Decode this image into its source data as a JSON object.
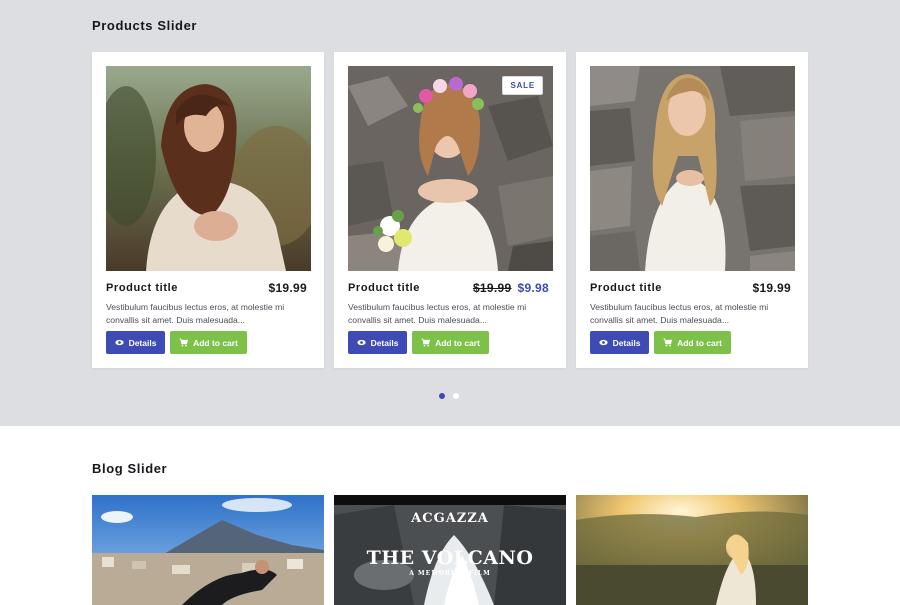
{
  "products_slider": {
    "title": "Products Slider",
    "products": [
      {
        "title": "Product title",
        "price": "$19.99",
        "description": "Vestibulum faucibus lectus eros, at molestie mi convallis sit amet. Duis malesuada...",
        "details_label": "Details",
        "cart_label": "Add to cart"
      },
      {
        "title": "Product title",
        "badge": "SALE",
        "old_price": "$19.99",
        "price": "$9.98",
        "description": "Vestibulum faucibus lectus eros, at molestie mi convallis sit amet. Duis malesuada...",
        "details_label": "Details",
        "cart_label": "Add to cart"
      },
      {
        "title": "Product title",
        "price": "$19.99",
        "description": "Vestibulum faucibus lectus eros, at molestie mi convallis sit amet. Duis malesuada...",
        "details_label": "Details",
        "cart_label": "Add to cart"
      }
    ],
    "pagination": {
      "pages": 2,
      "active_page": 1
    }
  },
  "blog_slider": {
    "title": "Blog Slider",
    "posts": [
      {
        "image": "city-mountain-photo"
      },
      {
        "image": "volcano-poster-photo",
        "poster_brand": "ACGAZZA",
        "poster_title": "THE VOLCANO",
        "poster_subtitle": "A MEMORIAL FILM"
      },
      {
        "image": "sunset-woman-photo"
      }
    ]
  },
  "colors": {
    "accent": "#3e4bb5",
    "cart_green": "#7ec14a",
    "section_bg": "#dcdee2",
    "sale_price": "#3d4ab8"
  },
  "icons": {
    "details": "eye-icon",
    "cart": "cart-icon"
  }
}
